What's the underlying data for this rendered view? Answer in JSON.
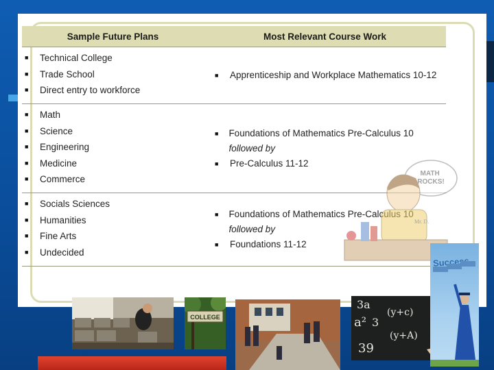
{
  "table": {
    "headers": [
      "Sample Future Plans",
      "Most Relevant Course Work"
    ],
    "rows": [
      {
        "plans": [
          "Technical College",
          "Trade School",
          "Direct entry to workforce"
        ],
        "courses": [
          {
            "text": "Apprenticeship and Workplace Mathematics 10-12",
            "emph": "",
            "tail": ""
          }
        ]
      },
      {
        "plans": [
          "Math",
          "Science",
          "Engineering",
          "Medicine",
          "Commerce"
        ],
        "courses": [
          {
            "text": "Foundations of Mathematics Pre-Calculus 10 ",
            "emph": "followed by",
            "tail": ""
          },
          {
            "text": "Pre-Calculus 11-12",
            "emph": "",
            "tail": ""
          }
        ]
      },
      {
        "plans": [
          "Socials Sciences",
          "Humanities",
          "Fine Arts",
          "Undecided"
        ],
        "courses": [
          {
            "text": "Foundations of Mathematics Pre-Calculus 10 ",
            "emph": "followed by",
            "tail": ""
          },
          {
            "text": "Foundations 11-12",
            "emph": "",
            "tail": ""
          }
        ]
      }
    ]
  },
  "bullet_glyph": "■",
  "illustrations": {
    "teacher_bubble": "MATH ROCKS!",
    "teacher_name": "Mr. D.",
    "college_sign": "COLLEGE",
    "success_word": "Success",
    "chalk_lines": [
      "3a",
      "a²",
      "3",
      "39",
      "(y+c)",
      "(y+A)"
    ]
  }
}
